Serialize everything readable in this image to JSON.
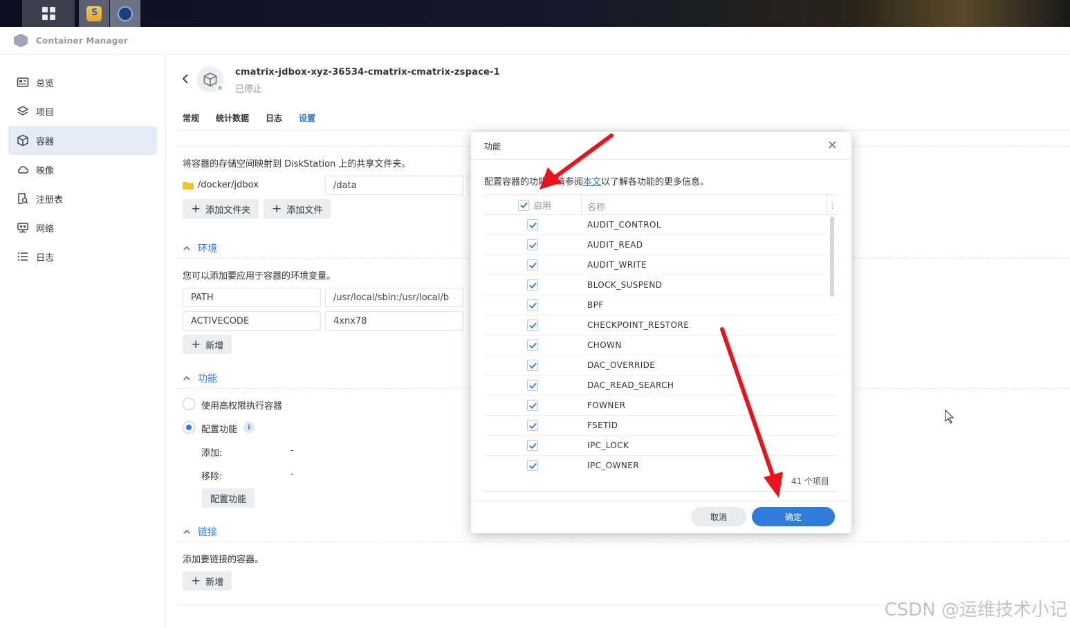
{
  "app": {
    "title": "Container Manager"
  },
  "sidebar": {
    "items": [
      {
        "label": "总览",
        "icon": "overview-icon"
      },
      {
        "label": "项目",
        "icon": "layers-icon"
      },
      {
        "label": "容器",
        "icon": "box-icon",
        "active": true
      },
      {
        "label": "映像",
        "icon": "cloud-icon"
      },
      {
        "label": "注册表",
        "icon": "registry-search-icon"
      },
      {
        "label": "网络",
        "icon": "network-icon"
      },
      {
        "label": "日志",
        "icon": "list-icon"
      }
    ]
  },
  "container": {
    "name": "cmatrix-jdbox-xyz-36534-cmatrix-cmatrix-zspace-1",
    "status": "已停止"
  },
  "tabs": [
    "常规",
    "统计数据",
    "日志",
    "设置"
  ],
  "volume": {
    "desc": "将容器的存储空间映射到 DiskStation 上的共享文件夹。",
    "folder": "/docker/jdbox",
    "mount": "/data",
    "add_folder": "添加文件夹",
    "add_file": "添加文件"
  },
  "env": {
    "title": "环境",
    "desc": "您可以添加要应用于容器的环境变量。",
    "vars": [
      {
        "key": "PATH",
        "value": "/usr/local/sbin:/usr/local/b"
      },
      {
        "key": "ACTIVECODE",
        "value": "4xnx78"
      }
    ],
    "add": "新增"
  },
  "caps": {
    "title": "功能",
    "opt_privileged": "使用高权限执行容器",
    "opt_config": "配置功能",
    "add_label": "添加:",
    "add_value": "-",
    "remove_label": "移除:",
    "remove_value": "-",
    "config_button": "配置功能"
  },
  "links": {
    "title": "链接",
    "desc": "添加要链接的容器。",
    "add": "新增"
  },
  "dialog": {
    "title": "功能",
    "close": "×",
    "desc_before": "配置容器的功能。请参阅",
    "desc_link": "本文",
    "desc_after": "以了解各功能的更多信息。",
    "col_enable": "启用",
    "col_name": "名称",
    "rows": [
      "AUDIT_CONTROL",
      "AUDIT_READ",
      "AUDIT_WRITE",
      "BLOCK_SUSPEND",
      "BPF",
      "CHECKPOINT_RESTORE",
      "CHOWN",
      "DAC_OVERRIDE",
      "DAC_READ_SEARCH",
      "FOWNER",
      "FSETID",
      "IPC_LOCK",
      "IPC_OWNER"
    ],
    "count": "41 个项目",
    "cancel": "取消",
    "ok": "确定"
  },
  "colors": {
    "accent": "#2f7bd9",
    "arrow": "#e8141c"
  },
  "watermark": "CSDN @运维技术小记"
}
